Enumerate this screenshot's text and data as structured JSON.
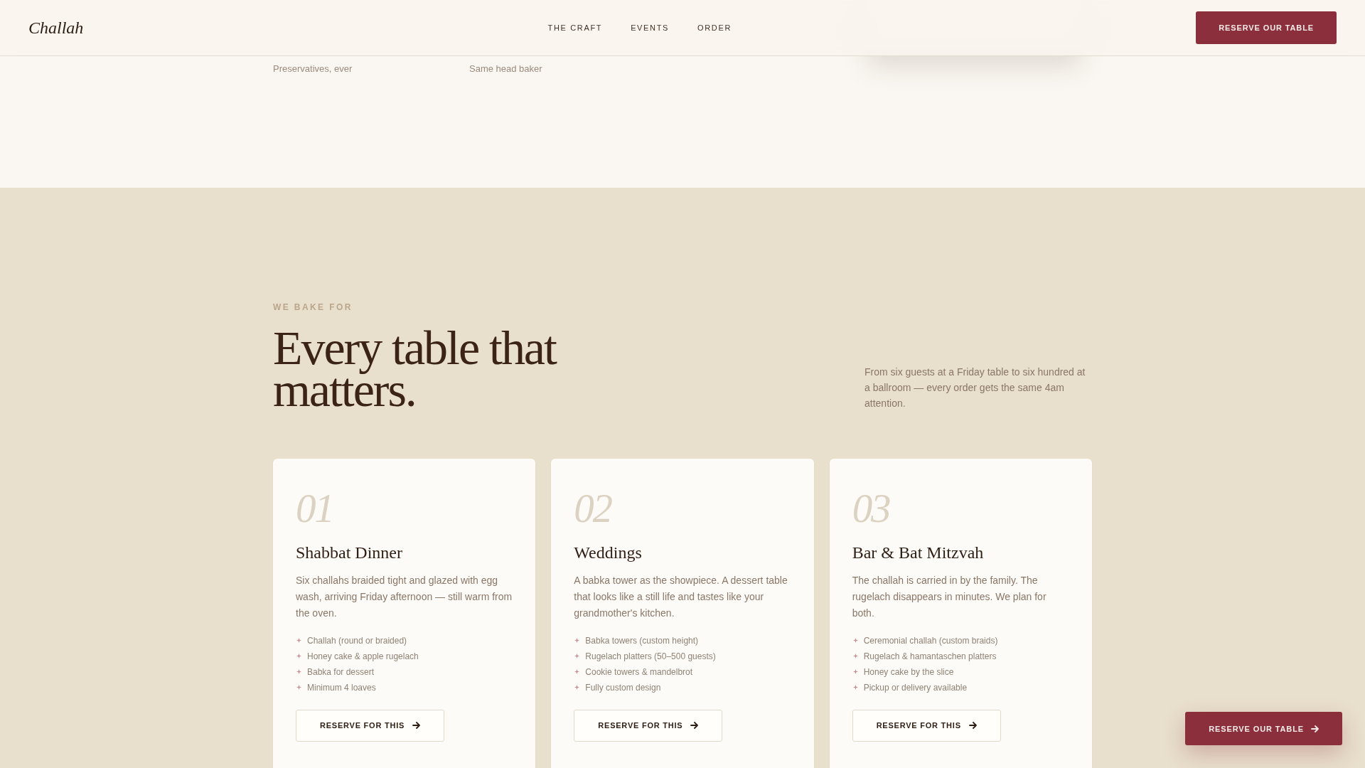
{
  "header": {
    "logo": "Challah",
    "nav": [
      {
        "label": "THE CRAFT"
      },
      {
        "label": "EVENTS"
      },
      {
        "label": "ORDER"
      }
    ],
    "cta": "RESERVE OUR TABLE"
  },
  "hero": {
    "stats": [
      {
        "label": "Preservatives, ever"
      },
      {
        "label": "Same head baker"
      }
    ]
  },
  "events": {
    "eyebrow": "WE BAKE FOR",
    "title": "Every table that matters.",
    "intro": "From six guests at a Friday table to six hundred at a ballroom — every order gets the same 4am attention.",
    "cards": [
      {
        "number": "01",
        "title": "Shabbat Dinner",
        "description": "Six challahs braided tight and glazed with egg wash, arriving Friday afternoon — still warm from the oven.",
        "items": [
          "Challah (round or braided)",
          "Honey cake & apple rugelach",
          "Babka for dessert",
          "Minimum 4 loaves"
        ],
        "button": "RESERVE FOR THIS"
      },
      {
        "number": "02",
        "title": "Weddings",
        "description": "A babka tower as the showpiece. A dessert table that looks like a still life and tastes like your grandmother's kitchen.",
        "items": [
          "Babka towers (custom height)",
          "Rugelach platters (50–500 guests)",
          "Cookie towers & mandelbrot",
          "Fully custom design"
        ],
        "button": "RESERVE FOR THIS"
      },
      {
        "number": "03",
        "title": "Bar & Bat Mitzvah",
        "description": "The challah is carried in by the family. The rugelach disappears in minutes. We plan for both.",
        "items": [
          "Ceremonial challah (custom braids)",
          "Rugelach & hamantaschen platters",
          "Honey cake by the slice",
          "Pickup or delivery available"
        ],
        "button": "RESERVE FOR THIS"
      }
    ]
  },
  "floating_button": {
    "label": "RESERVE OUR TABLE"
  }
}
